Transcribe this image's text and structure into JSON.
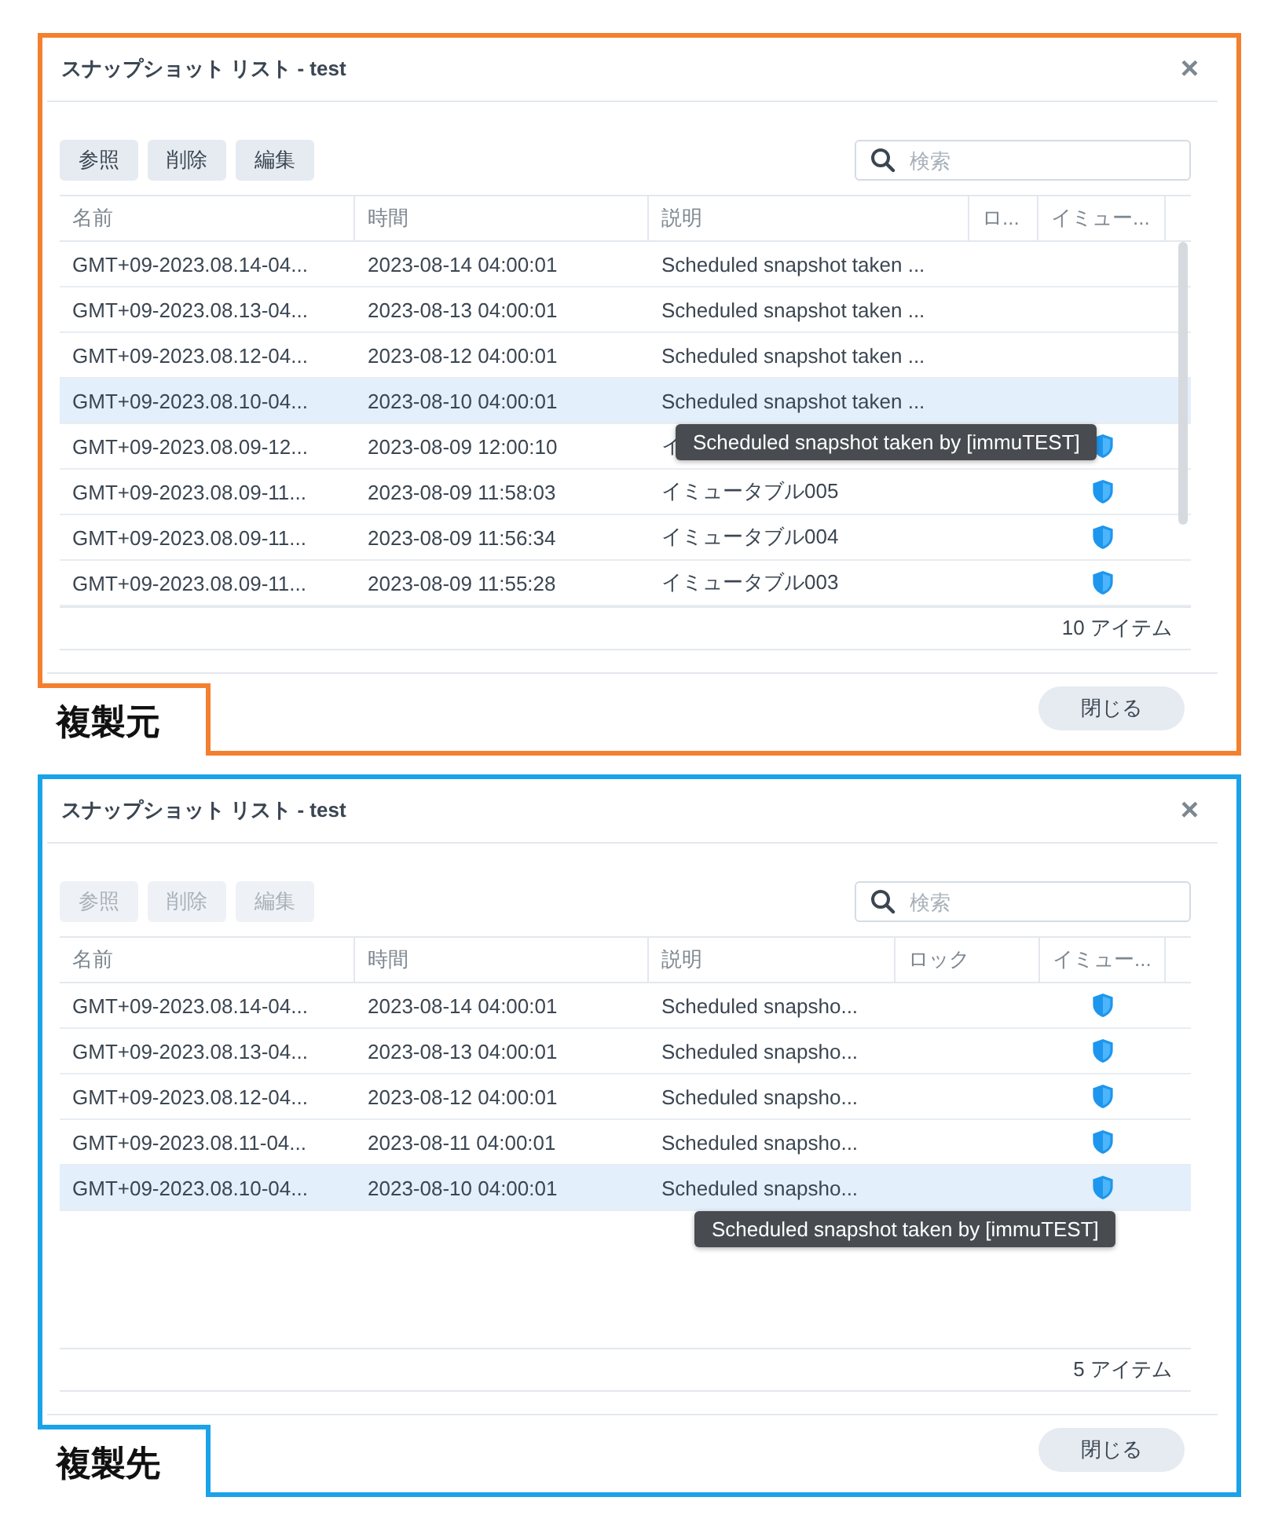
{
  "panels": [
    {
      "color": "#f47f2f",
      "title": "スナップショット リスト - test",
      "close_icon": "×",
      "buttons": [
        {
          "label": "参照",
          "disabled": false
        },
        {
          "label": "削除",
          "disabled": false
        },
        {
          "label": "編集",
          "disabled": false
        }
      ],
      "search": {
        "placeholder": "検索"
      },
      "columns": [
        "名前",
        "時間",
        "説明",
        "ロ...",
        "イミュー..."
      ],
      "scrollable": true,
      "rows": [
        {
          "name": "GMT+09-2023.08.14-04...",
          "time": "2023-08-14 04:00:01",
          "description": "Scheduled snapshot taken ...",
          "immutable": false,
          "selected": false
        },
        {
          "name": "GMT+09-2023.08.13-04...",
          "time": "2023-08-13 04:00:01",
          "description": "Scheduled snapshot taken ...",
          "immutable": false,
          "selected": false
        },
        {
          "name": "GMT+09-2023.08.12-04...",
          "time": "2023-08-12 04:00:01",
          "description": "Scheduled snapshot taken ...",
          "immutable": false,
          "selected": false
        },
        {
          "name": "GMT+09-2023.08.10-04...",
          "time": "2023-08-10 04:00:01",
          "description": "Scheduled snapshot taken ...",
          "immutable": false,
          "selected": true,
          "tooltip": "Scheduled snapshot taken by [immuTEST]"
        },
        {
          "name": "GMT+09-2023.08.09-12...",
          "time": "2023-08-09 12:00:10",
          "description": "イ",
          "immutable": true,
          "selected": false
        },
        {
          "name": "GMT+09-2023.08.09-11...",
          "time": "2023-08-09 11:58:03",
          "description": "イミュータブル005",
          "immutable": true,
          "selected": false
        },
        {
          "name": "GMT+09-2023.08.09-11...",
          "time": "2023-08-09 11:56:34",
          "description": "イミュータブル004",
          "immutable": true,
          "selected": false
        },
        {
          "name": "GMT+09-2023.08.09-11...",
          "time": "2023-08-09 11:55:28",
          "description": "イミュータブル003",
          "immutable": true,
          "selected": false
        }
      ],
      "count": "10 アイテム",
      "close_button": "閉じる",
      "tag": "複製元"
    },
    {
      "color": "#1aa3e8",
      "title": "スナップショット リスト - test",
      "close_icon": "×",
      "buttons": [
        {
          "label": "参照",
          "disabled": true
        },
        {
          "label": "削除",
          "disabled": true
        },
        {
          "label": "編集",
          "disabled": true
        }
      ],
      "search": {
        "placeholder": "検索"
      },
      "columns": [
        "名前",
        "時間",
        "説明",
        "ロック",
        "イミュー..."
      ],
      "scrollable": false,
      "rows": [
        {
          "name": "GMT+09-2023.08.14-04...",
          "time": "2023-08-14 04:00:01",
          "description": "Scheduled snapsho...",
          "immutable": true,
          "selected": false
        },
        {
          "name": "GMT+09-2023.08.13-04...",
          "time": "2023-08-13 04:00:01",
          "description": "Scheduled snapsho...",
          "immutable": true,
          "selected": false
        },
        {
          "name": "GMT+09-2023.08.12-04...",
          "time": "2023-08-12 04:00:01",
          "description": "Scheduled snapsho...",
          "immutable": true,
          "selected": false
        },
        {
          "name": "GMT+09-2023.08.11-04...",
          "time": "2023-08-11 04:00:01",
          "description": "Scheduled snapsho...",
          "immutable": true,
          "selected": false
        },
        {
          "name": "GMT+09-2023.08.10-04...",
          "time": "2023-08-10 04:00:01",
          "description": "Scheduled snapsho...",
          "immutable": true,
          "selected": true,
          "tooltip": "Scheduled snapshot taken by [immuTEST]"
        }
      ],
      "count": "5 アイテム",
      "close_button": "閉じる",
      "tag": "複製先"
    }
  ]
}
